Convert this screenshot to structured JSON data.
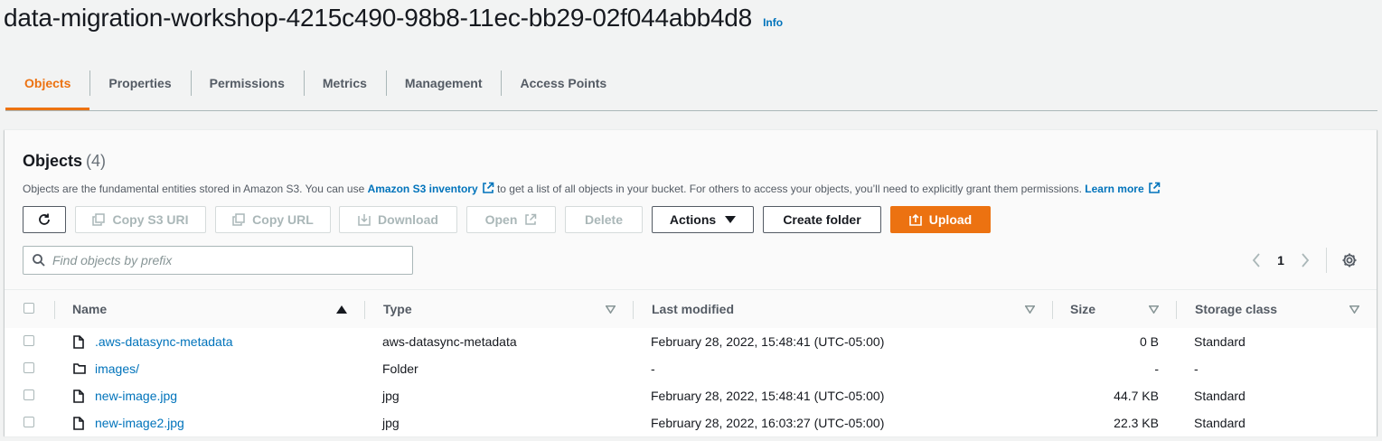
{
  "bucket": {
    "title": "data-migration-workshop-4215c490-98b8-11ec-bb29-02f044abb4d8",
    "info": "Info"
  },
  "tabs": [
    {
      "label": "Objects",
      "active": true
    },
    {
      "label": "Properties"
    },
    {
      "label": "Permissions"
    },
    {
      "label": "Metrics"
    },
    {
      "label": "Management"
    },
    {
      "label": "Access Points"
    }
  ],
  "objects_panel": {
    "heading": "Objects",
    "count": "(4)",
    "desc_1": "Objects are the fundamental entities stored in Amazon S3. You can use",
    "desc_link_inventory": "Amazon S3 inventory",
    "desc_2": "to get a list of all objects in your bucket. For others to access your objects, you’ll need to explicitly grant them permissions.",
    "desc_link_learn": "Learn more"
  },
  "toolbar": {
    "copy_s3_uri": "Copy S3 URI",
    "copy_url": "Copy URL",
    "download": "Download",
    "open": "Open",
    "delete": "Delete",
    "actions": "Actions",
    "create_folder": "Create folder",
    "upload": "Upload"
  },
  "search": {
    "placeholder": "Find objects by prefix"
  },
  "pagination": {
    "page": "1"
  },
  "table": {
    "headers": {
      "name": "Name",
      "type": "Type",
      "last_modified": "Last modified",
      "size": "Size",
      "storage_class": "Storage class"
    },
    "rows": [
      {
        "name": ".aws-datasync-metadata",
        "kind": "file",
        "type": "aws-datasync-metadata",
        "last_modified": "February 28, 2022, 15:48:41 (UTC-05:00)",
        "size": "0 B",
        "storage_class": "Standard"
      },
      {
        "name": "images/",
        "kind": "folder",
        "type": "Folder",
        "last_modified": "-",
        "size": "-",
        "storage_class": "-"
      },
      {
        "name": "new-image.jpg",
        "kind": "file",
        "type": "jpg",
        "last_modified": "February 28, 2022, 15:48:41 (UTC-05:00)",
        "size": "44.7 KB",
        "storage_class": "Standard"
      },
      {
        "name": "new-image2.jpg",
        "kind": "file",
        "type": "jpg",
        "last_modified": "February 28, 2022, 16:03:27 (UTC-05:00)",
        "size": "22.3 KB",
        "storage_class": "Standard"
      }
    ]
  },
  "colors": {
    "accent": "#ec7211",
    "link": "#0073bb",
    "text": "#16191f",
    "muted": "#545b64",
    "disabled": "#aab7b8"
  },
  "icons": [
    "refresh-icon",
    "copy-icon",
    "download-icon",
    "external-link-icon",
    "caret-down-icon",
    "upload-icon",
    "search-icon",
    "chevron-left-icon",
    "chevron-right-icon",
    "gear-icon",
    "file-icon",
    "folder-icon",
    "sort-asc-icon",
    "sort-icon"
  ]
}
